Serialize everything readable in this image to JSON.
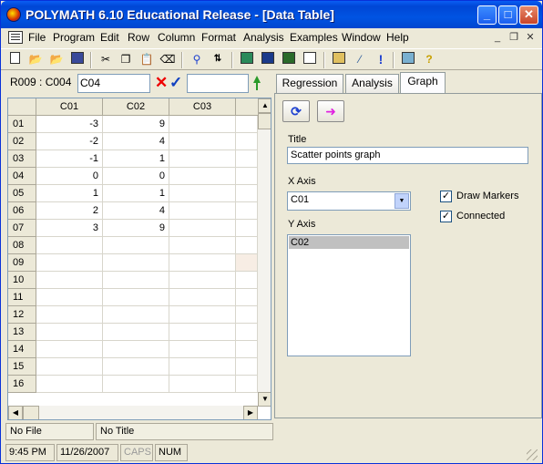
{
  "window": {
    "title": "POLYMATH 6.10 Educational Release - [Data Table]"
  },
  "menu": {
    "items": [
      "File",
      "Program",
      "Edit",
      "Row",
      "Column",
      "Format",
      "Analysis",
      "Examples",
      "Window",
      "Help"
    ]
  },
  "toolbar": {
    "icons": [
      "new-file-icon",
      "open-folder-icon",
      "open-example-icon",
      "save-icon",
      "cut-icon",
      "copy-icon",
      "paste-icon",
      "eraser-icon",
      "find-icon",
      "sort-icon",
      "graph-window-icon",
      "function-icon",
      "data-table-icon",
      "grid-window-icon",
      "calculator-icon",
      "wand-icon",
      "exclamation-icon",
      "table-icon",
      "help-icon"
    ]
  },
  "cell_editor": {
    "reference": "R009 : C004",
    "value": "C04",
    "value2": ""
  },
  "table": {
    "columns": [
      "C01",
      "C02",
      "C03"
    ],
    "rows": [
      {
        "label": "01",
        "c01": "-3",
        "c02": "9"
      },
      {
        "label": "02",
        "c01": "-2",
        "c02": "4"
      },
      {
        "label": "03",
        "c01": "-1",
        "c02": "1"
      },
      {
        "label": "04",
        "c01": "0",
        "c02": "0"
      },
      {
        "label": "05",
        "c01": "1",
        "c02": "1"
      },
      {
        "label": "06",
        "c01": "2",
        "c02": "4"
      },
      {
        "label": "07",
        "c01": "3",
        "c02": "9"
      },
      {
        "label": "08",
        "c01": "",
        "c02": ""
      },
      {
        "label": "09",
        "c01": "",
        "c02": ""
      },
      {
        "label": "10",
        "c01": "",
        "c02": ""
      },
      {
        "label": "11",
        "c01": "",
        "c02": ""
      },
      {
        "label": "12",
        "c01": "",
        "c02": ""
      },
      {
        "label": "13",
        "c01": "",
        "c02": ""
      },
      {
        "label": "14",
        "c01": "",
        "c02": ""
      },
      {
        "label": "15",
        "c01": "",
        "c02": ""
      },
      {
        "label": "16",
        "c01": "",
        "c02": ""
      }
    ]
  },
  "tabs": [
    "Regression",
    "Analysis",
    "Graph"
  ],
  "graph_panel": {
    "title_label": "Title",
    "title_value": "Scatter points graph",
    "x_axis_label": "X Axis",
    "x_axis_value": "C01",
    "y_axis_label": "Y Axis",
    "y_axis_items": [
      "C02"
    ],
    "draw_markers_label": "Draw Markers",
    "draw_markers_checked": true,
    "connected_label": "Connected",
    "connected_checked": true,
    "check_mark": "✓"
  },
  "status": {
    "file": "No File",
    "title": "No Title",
    "time": "9:45 PM",
    "date": "11/26/2007",
    "caps": "CAPS",
    "num": "NUM"
  },
  "colors": {
    "titlebar": "#0054e3",
    "cancel_red": "#e00000",
    "confirm_blue": "#1040c0",
    "refresh_blue": "#1c3fd0",
    "arrow_magenta": "#e020e0"
  }
}
